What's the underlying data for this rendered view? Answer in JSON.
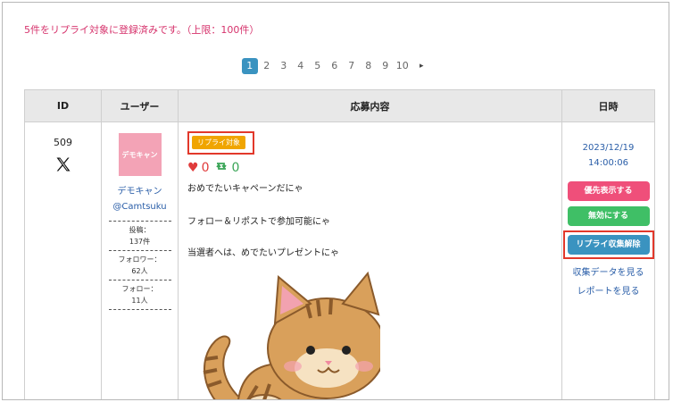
{
  "notice": "5件をリプライ対象に登録済みです。（上限：100件）",
  "pagination": {
    "pages": [
      "1",
      "2",
      "3",
      "4",
      "5",
      "6",
      "7",
      "8",
      "9",
      "10"
    ],
    "active": "1",
    "next": "▸"
  },
  "table": {
    "headers": {
      "id": "ID",
      "user": "ユーザー",
      "content": "応募内容",
      "date": "日時"
    },
    "row": {
      "id": "509",
      "platform_icon": "x-logo-icon",
      "user": {
        "avatar_text": "デモキャン",
        "name": "デモキャン",
        "handle": "@Camtsuku",
        "posts_label": "投稿：",
        "posts_value": "137件",
        "followers_label": "フォロワー：",
        "followers_value": "62人",
        "following_label": "フォロー：",
        "following_value": "11人"
      },
      "content": {
        "tag": "リプライ対象",
        "likes": "0",
        "retweets": "0",
        "lines": [
          "おめでたいキャペーンだにゃ",
          "フォロー＆リポストで参加可能にゃ",
          "当選者へは、めでたいプレゼントにゃ"
        ]
      },
      "date": {
        "day": "2023/12/19",
        "time": "14:00:06",
        "btn_priority": "優先表示する",
        "btn_disable": "無効にする",
        "btn_reply_release": "リプライ収集解除",
        "link_data": "収集データを見る",
        "link_report": "レポートを見る"
      }
    }
  },
  "colors": {
    "notice": "#d6336c",
    "accent_blue": "#3a93c0",
    "pink_button": "#ef4f7a",
    "green_button": "#3fbf66",
    "tag_orange": "#f0a500",
    "highlight_red": "#e2382b"
  }
}
